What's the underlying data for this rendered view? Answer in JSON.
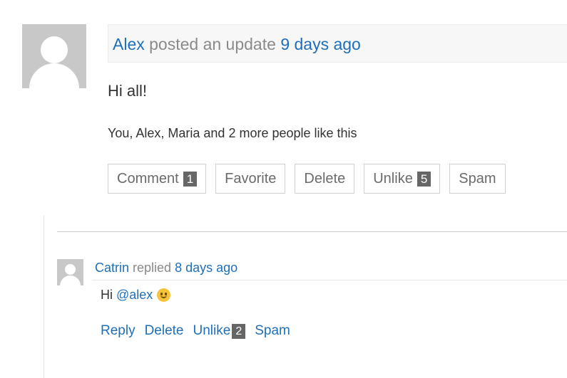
{
  "activity": {
    "author": "Alex",
    "action": "posted an update",
    "time": "9 days ago",
    "content": "Hi all!",
    "likes_text": "You, Alex, Maria and 2 more people like this",
    "buttons": {
      "comment": {
        "label": "Comment",
        "count": "1"
      },
      "favorite": {
        "label": "Favorite"
      },
      "delete": {
        "label": "Delete"
      },
      "unlike": {
        "label": "Unlike",
        "count": "5"
      },
      "spam": {
        "label": "Spam"
      }
    }
  },
  "reply": {
    "author": "Catrin",
    "action": "replied",
    "time": "8 days ago",
    "greeting": "Hi",
    "mention": "@alex",
    "actions": {
      "reply": "Reply",
      "delete": "Delete",
      "unlike": "Unlike",
      "unlike_count": "2",
      "spam": "Spam"
    }
  },
  "colors": {
    "link": "#1f6fb8",
    "muted": "#8a8a8a",
    "badge": "#666666"
  }
}
